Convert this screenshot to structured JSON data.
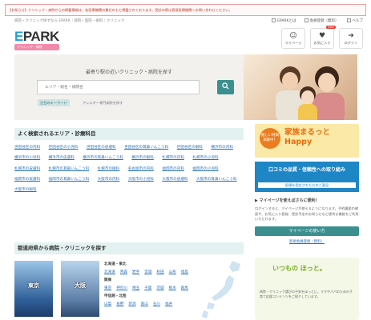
{
  "notice": "【お知らせ】クリニック・病院からの掲載情報は、各医療機関の責任のもと掲載されております。受診の際は直接医療機関へお問い合わせください。",
  "breadcrumb": "病院・クリニック探すなら EPARK｜病院・医院・歯科｜クリニック",
  "top_links": [
    "EPARKとは",
    "会員登録（無料）",
    "ヘルプ"
  ],
  "logo": {
    "main": "EPARK",
    "sub": "クリニック・病院"
  },
  "header_icons": [
    {
      "label": "マイページ",
      "glyph": "☺"
    },
    {
      "label": "お気に入り",
      "glyph": "♥",
      "badge": "New"
    },
    {
      "label": "ログイン",
      "glyph": "➜"
    }
  ],
  "hero": {
    "title": "最寄り駅の近いクリニック・病院を探す",
    "search_placeholder": "エリア・駅名・病院名",
    "search_icon": "magnifier-icon",
    "pills": [
      "注目のキーワード",
      "アレルギー専門病院を探す"
    ]
  },
  "areas_section": {
    "title": "よく検索されるエリア・診療科目",
    "links": [
      "世田谷区の内科",
      "世田谷区の小児科",
      "世田谷区の皮膚科",
      "世田谷区の耳鼻いんこう科",
      "世田谷区の眼科",
      "横浜市の内科",
      "横浜市の小児科",
      "横浜市の皮膚科",
      "横浜市の耳鼻いんこう科",
      "横浜市の眼科",
      "札幌市の内科",
      "札幌市の小児科",
      "札幌市の皮膚科",
      "札幌市の耳鼻いんこう科",
      "札幌市の眼科",
      "名古屋市の内科",
      "福岡市の内科",
      "福岡市の小児科",
      "福岡市の皮膚科",
      "福岡市の耳鼻いんこう科",
      "大阪市の内科",
      "大阪市の小児科",
      "大阪市の皮膚科",
      "大阪市の耳鼻いんこう科",
      "大阪市の眼科"
    ]
  },
  "prefecture_section": {
    "title": "都道府県から病院・クリニックを探す",
    "cities": [
      "東京",
      "大阪"
    ],
    "regions": [
      {
        "name": "北海道・東北",
        "prefs": [
          "北海道",
          "青森",
          "岩手",
          "宮城",
          "秋田",
          "山形",
          "福島"
        ]
      },
      {
        "name": "関東",
        "prefs": [
          "東京",
          "神奈川",
          "埼玉",
          "千葉",
          "茨城",
          "栃木",
          "群馬"
        ]
      },
      {
        "name": "甲信越・北陸",
        "prefs": [
          "山梨",
          "長野",
          "新潟",
          "富山",
          "石川",
          "福井"
        ]
      }
    ]
  },
  "banner_happy": {
    "circle": "嬉しい特典満載中！",
    "text": "家族まるっとHappy"
  },
  "banner_kuchikomi": {
    "title": "口コミの品質・信頼性への取り組み",
    "sub": "医療を受診された方のご意見"
  },
  "mypage_box": {
    "title": "マイページを使えばさらに便利！",
    "desc": "ログインすると、マイページが使えるようになります。予約履歴の確認や、お気に入り登録、受診予定のお知らせなど便利な機能をご利用いただけます。",
    "button": "マイページの使い方",
    "link": "新規会員登録（無料）"
  },
  "hotto_box": {
    "title": "いつもの ほっと。",
    "desc": "病院・クリニック選びの不安をほっとに。ママやパパのための子育て応援コンテンツをご紹介しています。"
  },
  "colors": {
    "accent": "#3b8f8f",
    "link": "#2a73b8",
    "logo_blue": "#22a0d8"
  }
}
